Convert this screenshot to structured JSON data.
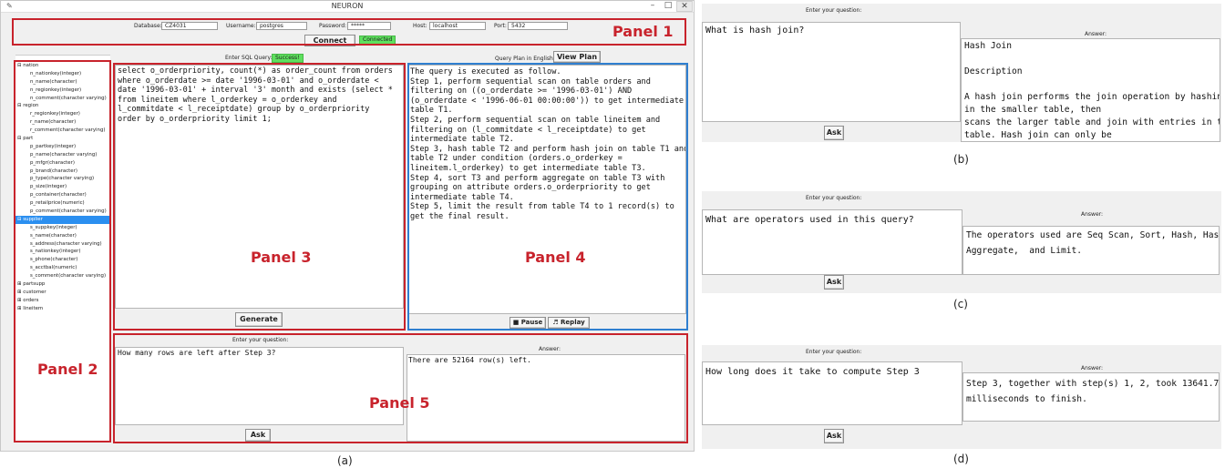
{
  "window": {
    "title": "NEURON",
    "minimize": "–",
    "maximize": "□",
    "close": "✕"
  },
  "connection": {
    "database_label": "Database:",
    "database_value": "CZ4031",
    "username_label": "Username:",
    "username_value": "postgres",
    "password_label": "Password:",
    "password_value": "*****",
    "host_label": "Host:",
    "host_value": "localhost",
    "port_label": "Port:",
    "port_value": "5432",
    "connect_button": "Connect",
    "status": "Connected"
  },
  "panel_labels": {
    "p1": "Panel 1",
    "p2": "Panel 2",
    "p3": "Panel 3",
    "p4": "Panel 4",
    "p5": "Panel 5"
  },
  "tree": [
    {
      "text": "⊟ nation",
      "level": 0,
      "selected": false
    },
    {
      "text": "n_nationkey(integer)",
      "level": 1,
      "selected": false
    },
    {
      "text": "n_name(character)",
      "level": 1,
      "selected": false
    },
    {
      "text": "n_regionkey(integer)",
      "level": 1,
      "selected": false
    },
    {
      "text": "n_comment(character varying)",
      "level": 1,
      "selected": false
    },
    {
      "text": "⊟ region",
      "level": 0,
      "selected": false
    },
    {
      "text": "r_regionkey(integer)",
      "level": 1,
      "selected": false
    },
    {
      "text": "r_name(character)",
      "level": 1,
      "selected": false
    },
    {
      "text": "r_comment(character varying)",
      "level": 1,
      "selected": false
    },
    {
      "text": "⊟ part",
      "level": 0,
      "selected": false
    },
    {
      "text": "p_partkey(integer)",
      "level": 1,
      "selected": false
    },
    {
      "text": "p_name(character varying)",
      "level": 1,
      "selected": false
    },
    {
      "text": "p_mfgr(character)",
      "level": 1,
      "selected": false
    },
    {
      "text": "p_brand(character)",
      "level": 1,
      "selected": false
    },
    {
      "text": "p_type(character varying)",
      "level": 1,
      "selected": false
    },
    {
      "text": "p_size(integer)",
      "level": 1,
      "selected": false
    },
    {
      "text": "p_container(character)",
      "level": 1,
      "selected": false
    },
    {
      "text": "p_retailprice(numeric)",
      "level": 1,
      "selected": false
    },
    {
      "text": "p_comment(character varying)",
      "level": 1,
      "selected": false
    },
    {
      "text": "⊟ supplier",
      "level": 0,
      "selected": true
    },
    {
      "text": "s_suppkey(integer)",
      "level": 1,
      "selected": false
    },
    {
      "text": "s_name(character)",
      "level": 1,
      "selected": false
    },
    {
      "text": "s_address(character varying)",
      "level": 1,
      "selected": false
    },
    {
      "text": "s_nationkey(integer)",
      "level": 1,
      "selected": false
    },
    {
      "text": "s_phone(character)",
      "level": 1,
      "selected": false
    },
    {
      "text": "s_acctbal(numeric)",
      "level": 1,
      "selected": false
    },
    {
      "text": "s_comment(character varying)",
      "level": 1,
      "selected": false
    },
    {
      "text": "⊞ partsupp",
      "level": 0,
      "selected": false
    },
    {
      "text": "⊞ customer",
      "level": 0,
      "selected": false
    },
    {
      "text": "⊞ orders",
      "level": 0,
      "selected": false
    },
    {
      "text": "⊞ lineitem",
      "level": 0,
      "selected": false
    }
  ],
  "sql": {
    "label": "Enter SQL Query:",
    "status": "Success!",
    "text": "select o_orderpriority, count(*) as order_count from orders\nwhere o_orderdate >= date '1996-03-01' and o_orderdate <\ndate '1996-03-01' + interval '3' month and exists (select *\nfrom lineitem where l_orderkey = o_orderkey and\nl_commitdate < l_receiptdate) group by o_orderpriority\norder by o_orderpriority limit 1;",
    "generate_button": "Generate"
  },
  "plan": {
    "label": "Query Plan in English:",
    "view_button": "View Plan",
    "text": "The query is executed as follow.\nStep 1, perform sequential scan on table orders and\nfiltering on ((o_orderdate >= '1996-03-01') AND\n(o_orderdate < '1996-06-01 00:00:00')) to get intermediate\ntable T1.\nStep 2, perform sequential scan on table lineitem and\nfiltering on (l_commitdate < l_receiptdate) to get\nintermediate table T2.\nStep 3, hash table T2 and perform hash join on table T1 and\ntable T2 under condition (orders.o_orderkey =\nlineitem.l_orderkey) to get intermediate table T3.\nStep 4, sort T3 and perform aggregate on table T3 with\ngrouping on attribute orders.o_orderpriority to get\nintermediate table T4.\nStep 5, limit the result from table T4 to 1 record(s) to\nget the final result.",
    "pause_button": "■ Pause",
    "replay_button": "♬ Replay"
  },
  "qa_main": {
    "question_label": "Enter your question:",
    "answer_label": "Answer:",
    "question": "How many rows are left after Step 3?",
    "answer": "There are 52164 row(s) left.",
    "ask_button": "Ask"
  },
  "qa_b": {
    "question_label": "Enter your question:",
    "answer_label": "Answer:",
    "question": "What is hash join?",
    "answer": "Hash Join\n\nDescription\n\nA hash join performs the join operation by hashing entries\nin the smaller table, then\nscans the larger table and join with entries in the hash\ntable. Hash join can only be",
    "ask_button": "Ask"
  },
  "qa_c": {
    "question_label": "Enter your question:",
    "answer_label": "Answer:",
    "question": "What are operators used in this query?",
    "answer": "The operators used are Seq Scan, Sort, Hash, Hash Join,\nAggregate,  and Limit.",
    "ask_button": "Ask"
  },
  "qa_d": {
    "question_label": "Enter your question:",
    "answer_label": "Answer:",
    "question": "How long does it take to compute Step 3",
    "answer": "Step 3, together with step(s) 1, 2, took 13641.774\nmilliseconds to finish.",
    "ask_button": "Ask"
  },
  "captions": {
    "a": "(a)",
    "b": "(b)",
    "c": "(c)",
    "d": "(d)"
  }
}
